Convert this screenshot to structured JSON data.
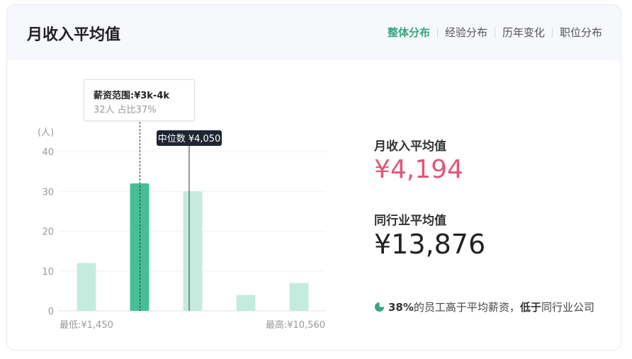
{
  "header": {
    "title": "月收入平均值",
    "tabs": [
      {
        "label": "整体分布",
        "active": true
      },
      {
        "label": "经验分布",
        "active": false
      },
      {
        "label": "历年变化",
        "active": false
      },
      {
        "label": "职位分布",
        "active": false
      }
    ]
  },
  "tooltip": {
    "title": "薪资范围:¥3k-4k",
    "subtitle": "32人  占比37%"
  },
  "median_label": "中位数 ¥4,050",
  "chart_data": {
    "type": "bar",
    "ylabel": "(人)",
    "ylim": [
      0,
      40
    ],
    "yticks": [
      0,
      10,
      20,
      30,
      40
    ],
    "values": [
      12,
      32,
      30,
      4,
      7
    ],
    "highlight_index": 1,
    "median_bar_index": 2,
    "x_min_label": "最低:¥1,450",
    "x_max_label": "最高:¥10,560",
    "grid": true,
    "colors": {
      "normal": "#c5ebdf",
      "highlight": "#46bf95",
      "median_line": "#333333"
    }
  },
  "stats": {
    "avg_label": "月收入平均值",
    "avg_value": "¥4,194",
    "industry_label": "同行业平均值",
    "industry_value": "¥13,876"
  },
  "note": {
    "percent": "38%",
    "part1": "的员工高于平均薪资，",
    "bold2": "低于",
    "part2": "同行业公司",
    "icon": "pie-chart-icon",
    "icon_color": "#3aa57d"
  }
}
